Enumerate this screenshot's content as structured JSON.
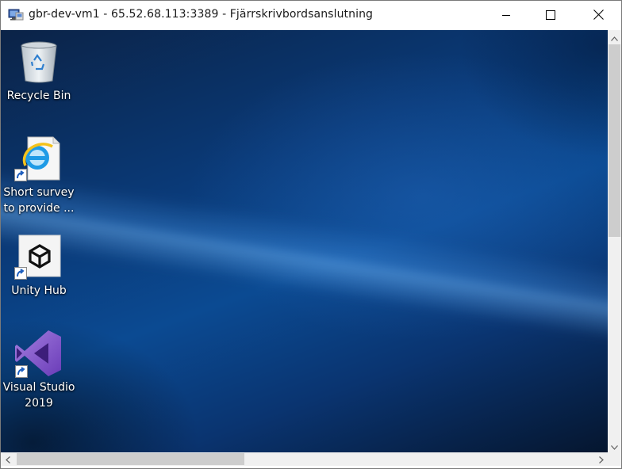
{
  "window": {
    "title": "gbr-dev-vm1 - 65.52.68.113:3389 - Fjärrskrivbordsanslutning",
    "icon": "remote-desktop-icon",
    "controls": [
      "minimize-icon",
      "maximize-icon",
      "close-icon"
    ]
  },
  "desktop": {
    "icons": [
      {
        "label_line1": "Recycle Bin",
        "label_line2": "",
        "icon": "recycle-bin-icon",
        "shortcut": false
      },
      {
        "label_line1": "Short survey",
        "label_line2": "to provide ...",
        "icon": "internet-explorer-icon",
        "shortcut": true
      },
      {
        "label_line1": "Unity Hub",
        "label_line2": "",
        "icon": "unity-hub-icon",
        "shortcut": true
      },
      {
        "label_line1": "Visual Studio",
        "label_line2": "2019",
        "icon": "visual-studio-icon",
        "shortcut": true
      }
    ]
  },
  "colors": {
    "desktop_bg": "#0a3a78",
    "title_bar": "#ffffff",
    "scrollbar_track": "#f0f0f0",
    "scrollbar_thumb": "#cdcdcd",
    "vs_purple": "#865fc5"
  }
}
